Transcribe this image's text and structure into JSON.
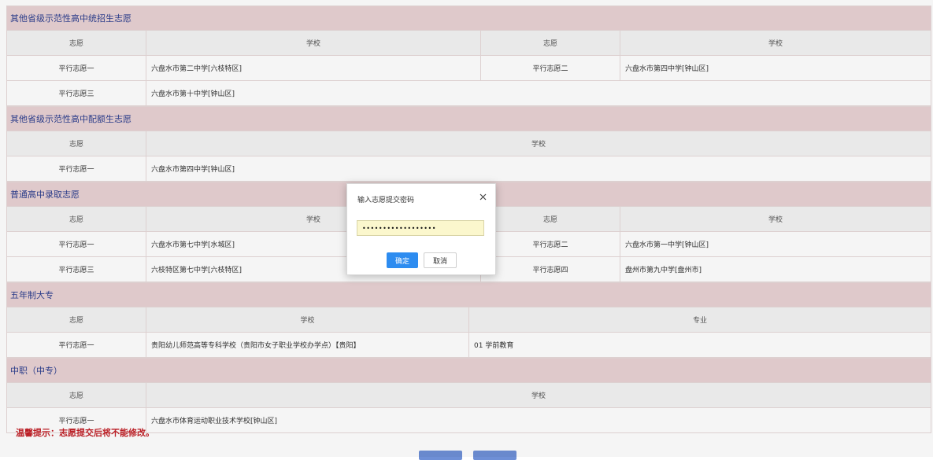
{
  "sections": {
    "s1": {
      "title": "其他省级示范性高中统招生志愿",
      "head": {
        "wish": "志愿",
        "school": "学校",
        "wish2": "志愿",
        "school2": "学校"
      },
      "rows": [
        {
          "w1": "平行志愿一",
          "s1": "六盘水市第二中学[六枝特区]",
          "w2": "平行志愿二",
          "s2": "六盘水市第四中学[钟山区]"
        },
        {
          "w1": "平行志愿三",
          "s1": "六盘水市第十中学[钟山区]"
        }
      ]
    },
    "s2": {
      "title": "其他省级示范性高中配额生志愿",
      "head": {
        "wish": "志愿",
        "school": "学校"
      },
      "rows": [
        {
          "w1": "平行志愿一",
          "s1": "六盘水市第四中学[钟山区]"
        }
      ]
    },
    "s3": {
      "title": "普通高中录取志愿",
      "head": {
        "wish": "志愿",
        "school": "学校",
        "wish2": "志愿",
        "school2": "学校"
      },
      "rows": [
        {
          "w1": "平行志愿一",
          "s1": "六盘水市第七中学[水城区]",
          "w2": "平行志愿二",
          "s2": "六盘水市第一中学[钟山区]"
        },
        {
          "w1": "平行志愿三",
          "s1": "六枝特区第七中学[六枝特区]",
          "w2": "平行志愿四",
          "s2": "盘州市第九中学[盘州市]"
        }
      ]
    },
    "s4": {
      "title": "五年制大专",
      "head": {
        "wish": "志愿",
        "school": "学校",
        "major": "专业"
      },
      "rows": [
        {
          "w1": "平行志愿一",
          "s1": "贵阳幼儿师范高等专科学校（贵阳市女子职业学校办学点）【贵阳】",
          "m1": "01 学前教育"
        }
      ]
    },
    "s5": {
      "title": "中职（中专）",
      "head": {
        "wish": "志愿",
        "school": "学校"
      },
      "rows": [
        {
          "w1": "平行志愿一",
          "s1": "六盘水市体育运动职业技术学校[钟山区]"
        }
      ]
    }
  },
  "notice": "温馨提示：志愿提交后将不能修改。",
  "dialog": {
    "title": "输入志愿提交密码",
    "password_value": "••••••••••••••••••",
    "ok_label": "确定",
    "cancel_label": "取消"
  },
  "colors": {
    "section_header_bg": "#e9d2d4",
    "section_header_text": "#2d3f8f",
    "notice_text": "#c21f26",
    "primary_button": "#2d8cf0"
  },
  "icons": {
    "close": "close-icon"
  }
}
